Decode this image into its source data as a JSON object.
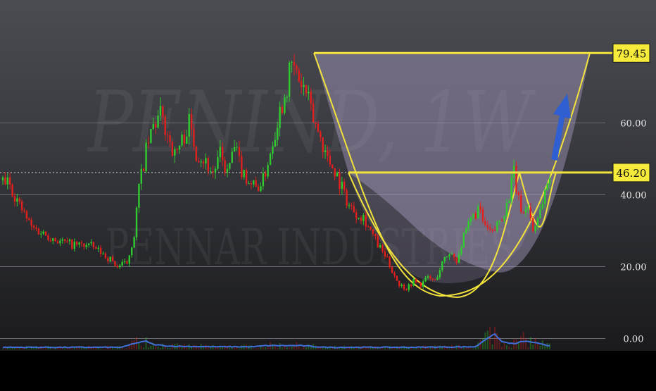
{
  "chart_data": {
    "type": "candlestick",
    "watermark": {
      "symbol": "PENIND, 1W",
      "name": "PENNAR INDUSTRIES"
    },
    "colors": {
      "up": "#2ecc2e",
      "down": "#e0201e",
      "volume_line": "#3f6fd8",
      "pattern": "#f2e33c",
      "pattern_fill": "#a89cc0",
      "arrow": "#2f5fd0",
      "grid": "#6a6c72",
      "axis_text": "#e8e8e8",
      "label_bg": "#f6ea3a"
    },
    "y_axis": {
      "ticks": [
        {
          "label": "60.00",
          "value": 60
        },
        {
          "label": "40.00",
          "value": 40
        },
        {
          "label": "20.00",
          "value": 20
        },
        {
          "label": "0.00",
          "value": 0
        }
      ],
      "ylim": [
        0,
        88
      ]
    },
    "price_labels": [
      {
        "label": "79.45",
        "value": 79.45
      },
      {
        "label": "46.20",
        "value": 46.2
      }
    ],
    "current_price": 46.2,
    "price_anchors": [
      [
        0,
        44
      ],
      [
        3,
        43
      ],
      [
        7,
        37
      ],
      [
        12,
        31
      ],
      [
        18,
        29
      ],
      [
        24,
        27
      ],
      [
        30,
        26
      ],
      [
        36,
        26
      ],
      [
        41,
        24
      ],
      [
        45,
        22
      ],
      [
        48,
        20
      ],
      [
        52,
        21
      ],
      [
        55,
        29
      ],
      [
        57,
        42
      ],
      [
        60,
        52
      ],
      [
        63,
        59
      ],
      [
        66,
        62
      ],
      [
        69,
        57
      ],
      [
        72,
        51
      ],
      [
        75,
        55
      ],
      [
        78,
        60
      ],
      [
        81,
        52
      ],
      [
        84,
        50
      ],
      [
        88,
        46
      ],
      [
        91,
        51
      ],
      [
        94,
        46
      ],
      [
        97,
        53
      ],
      [
        100,
        47
      ],
      [
        103,
        44
      ],
      [
        106,
        42
      ],
      [
        109,
        44
      ],
      [
        112,
        52
      ],
      [
        115,
        61
      ],
      [
        118,
        68
      ],
      [
        121,
        76
      ],
      [
        124,
        72
      ],
      [
        127,
        68
      ],
      [
        130,
        61
      ],
      [
        133,
        56
      ],
      [
        136,
        50
      ],
      [
        139,
        47
      ],
      [
        142,
        42
      ],
      [
        145,
        37
      ],
      [
        148,
        35
      ],
      [
        151,
        34
      ],
      [
        154,
        30
      ],
      [
        157,
        26
      ],
      [
        160,
        23
      ],
      [
        163,
        19
      ],
      [
        166,
        15
      ],
      [
        169,
        14
      ],
      [
        172,
        16
      ],
      [
        175,
        15
      ],
      [
        178,
        17
      ],
      [
        181,
        16
      ],
      [
        184,
        21
      ],
      [
        187,
        24
      ],
      [
        190,
        22
      ],
      [
        193,
        28
      ],
      [
        196,
        33
      ],
      [
        199,
        36
      ],
      [
        202,
        31
      ],
      [
        205,
        29
      ],
      [
        208,
        33
      ],
      [
        211,
        37
      ],
      [
        214,
        46
      ],
      [
        216,
        38
      ],
      [
        218,
        35
      ],
      [
        220,
        37
      ],
      [
        222,
        30
      ],
      [
        225,
        36
      ],
      [
        227,
        41
      ],
      [
        229,
        45
      ]
    ],
    "volume_anchors": [
      [
        0,
        3
      ],
      [
        50,
        3
      ],
      [
        55,
        10
      ],
      [
        60,
        14
      ],
      [
        63,
        8
      ],
      [
        70,
        5
      ],
      [
        90,
        4
      ],
      [
        105,
        4
      ],
      [
        110,
        6
      ],
      [
        125,
        6
      ],
      [
        135,
        3
      ],
      [
        170,
        3
      ],
      [
        198,
        4
      ],
      [
        203,
        20
      ],
      [
        206,
        26
      ],
      [
        209,
        13
      ],
      [
        214,
        9
      ],
      [
        218,
        14
      ],
      [
        222,
        12
      ],
      [
        228,
        6
      ]
    ]
  }
}
